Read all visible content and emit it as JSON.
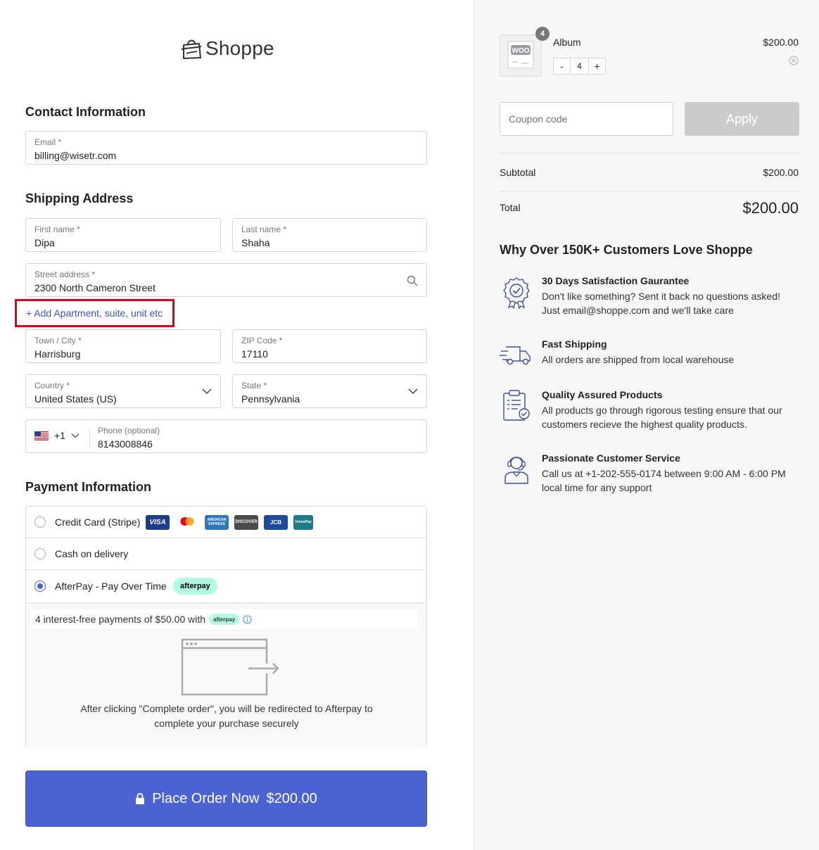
{
  "brand": {
    "name": "Shoppe"
  },
  "contact": {
    "title": "Contact Information",
    "email_label": "Email *",
    "email_value": "billing@wisetr.com"
  },
  "shipping": {
    "title": "Shipping Address",
    "first_name_label": "First name *",
    "first_name_value": "Dipa",
    "last_name_label": "Last name *",
    "last_name_value": "Shaha",
    "street_label": "Street address *",
    "street_value": "2300 North Cameron Street",
    "add_apartment": "+ Add Apartment, suite, unit etc",
    "city_label": "Town / City *",
    "city_value": "Harrisburg",
    "zip_label": "ZIP Code *",
    "zip_value": "17110",
    "country_label": "Country *",
    "country_value": "United States (US)",
    "state_label": "State *",
    "state_value": "Pennsylvania",
    "phone_code": "+1",
    "phone_label": "Phone (optional)",
    "phone_value": "8143008846"
  },
  "payment": {
    "title": "Payment Information",
    "methods": [
      {
        "label": "Credit Card (Stripe)",
        "selected": false
      },
      {
        "label": "Cash on delivery",
        "selected": false
      },
      {
        "label": "AfterPay - Pay Over Time",
        "selected": true
      }
    ],
    "cards": [
      "VISA",
      "",
      "AMERICAN EXPRESS",
      "DISCOVER",
      "JCB",
      "UnionPay"
    ],
    "afterpay_badge": "afterpay",
    "afterpay_line_prefix": "4 interest-free payments of $50.00 with",
    "afterpay_mini": "afterpay",
    "afterpay_note": "After clicking \"Complete order\", you will be redirected to Afterpay to complete your purchase securely"
  },
  "place_order": {
    "label": "Place Order Now",
    "amount": "$200.00"
  },
  "cart": {
    "item_name": "Album",
    "item_price": "$200.00",
    "quantity": "4",
    "thumb_text": "WOO",
    "minus": "-",
    "plus": "+"
  },
  "coupon": {
    "placeholder": "Coupon code",
    "apply_label": "Apply"
  },
  "summary": {
    "subtotal_label": "Subtotal",
    "subtotal_value": "$200.00",
    "total_label": "Total",
    "total_value": "$200.00"
  },
  "why": {
    "title": "Why Over 150K+ Customers Love Shoppe",
    "features": [
      {
        "title": "30 Days Satisfaction Gaurantee",
        "desc": "Don't like something? Sent it back no questions asked! Just email@shoppe.com and we'll take care"
      },
      {
        "title": "Fast Shipping",
        "desc": "All orders are shipped from local warehouse"
      },
      {
        "title": "Quality Assured Products",
        "desc": "All products go through rigorous testing ensure that our customers recieve the highest quality products."
      },
      {
        "title": "Passionate Customer Service",
        "desc": "Call us at +1-202-555-0174 between 9:00 AM - 6:00 PM local time for any support"
      }
    ]
  },
  "colors": {
    "accent": "#4b62d3",
    "highlight": "#e0001a",
    "link": "#3557c4",
    "afterpay": "#b2fce4"
  }
}
